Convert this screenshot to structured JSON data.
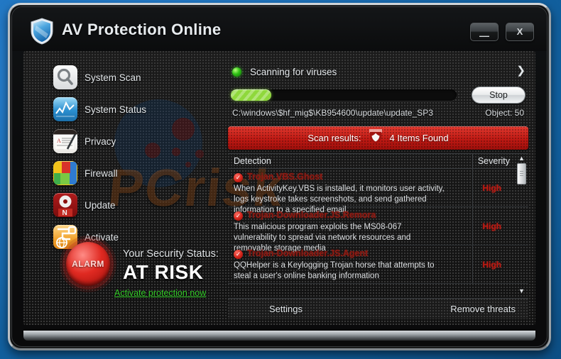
{
  "window": {
    "title": "AV Protection Online",
    "logo_icon": "shield-icon",
    "minimize_label": "—",
    "close_label": "X"
  },
  "sidebar": {
    "items": [
      {
        "label": "System Scan",
        "icon": "magnifier-icon"
      },
      {
        "label": "System Status",
        "icon": "chart-line-icon"
      },
      {
        "label": "Privacy",
        "icon": "document-pen-icon"
      },
      {
        "label": "Firewall",
        "icon": "brick-blocks-icon"
      },
      {
        "label": "Update",
        "icon": "disc-update-icon"
      },
      {
        "label": "Activate",
        "icon": "key-globe-icon"
      }
    ],
    "alarm_button_label": "ALARM",
    "security_status_label": "Your Security Status:",
    "security_status_value": "AT RISK",
    "activate_link": "Activate protection now",
    "status_color": "#ffffff",
    "link_color": "#35cc2a"
  },
  "scan": {
    "led_icon": "green-status-led-icon",
    "title": "Scanning for viruses",
    "chevron_icon": "chevron-down-icon",
    "progress_percent": 18,
    "stop_label": "Stop",
    "current_path": "C:\\windows\\$hf_mig$\\KB954600\\update\\update_SP3",
    "object_label": "Object:  50"
  },
  "results": {
    "label": "Scan results:",
    "shield_icon": "red-shield-icon",
    "count_text": "4 Items Found",
    "bar_color": "#c01a14"
  },
  "list": {
    "col_detection": "Detection",
    "col_severity": "Severity",
    "rows": [
      {
        "check_icon": "red-check-icon",
        "name": "Trojan.VBS.Ghost",
        "description": "When ActivityKey.VBS is installed, it monitors user activity, logs keystroke takes screenshots, and send gathered information to a specified email.",
        "severity": "High"
      },
      {
        "check_icon": "red-check-icon",
        "name": "Trojan-Downloader.JS.Remora",
        "description": "This malicious program exploits the MS08-067 vulnerability to spread via network resources and removable storage media",
        "severity": "High"
      },
      {
        "check_icon": "red-check-icon",
        "name": "Trojan-Downloader.JS.Agent",
        "description": "QQHelper is a Keylogging Trojan horse that attempts to steal a user's online banking information",
        "severity": "High"
      }
    ],
    "scroll_up_icon": "triangle-up-icon",
    "scroll_down_icon": "triangle-down-icon"
  },
  "footer": {
    "settings_label": "Settings",
    "remove_label": "Remove threats"
  },
  "watermark": {
    "text": "PCrisk"
  }
}
